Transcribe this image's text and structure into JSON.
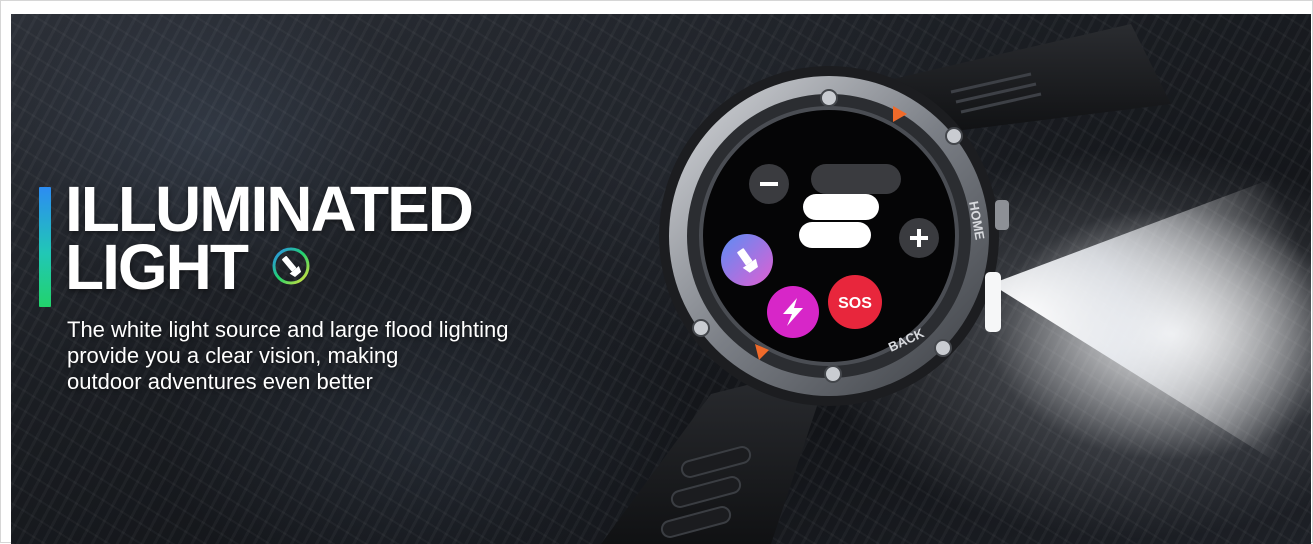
{
  "banner": {
    "headline_line1": "ILLUMINATED",
    "headline_line2": "LIGHT",
    "description_lines": [
      "The white light source and large flood lighting",
      "provide you a clear vision, making",
      "outdoor adventures even better"
    ],
    "badge_icon": "flashlight-icon"
  },
  "watch": {
    "bezel_label_top": "HOME",
    "bezel_label_bottom": "BACK",
    "screen_icons": [
      "minus-icon",
      "plus-icon",
      "flashlight-icon",
      "lightning-icon"
    ],
    "sos_label": "SOS"
  },
  "colors": {
    "accent_blue": "#2c8cf2",
    "accent_green": "#22d36c",
    "sos_red": "#e8263c",
    "flashlight_gradient": "#8a6cf0",
    "lightning_magenta": "#d726c8",
    "bezel_orange": "#f06a2a"
  }
}
